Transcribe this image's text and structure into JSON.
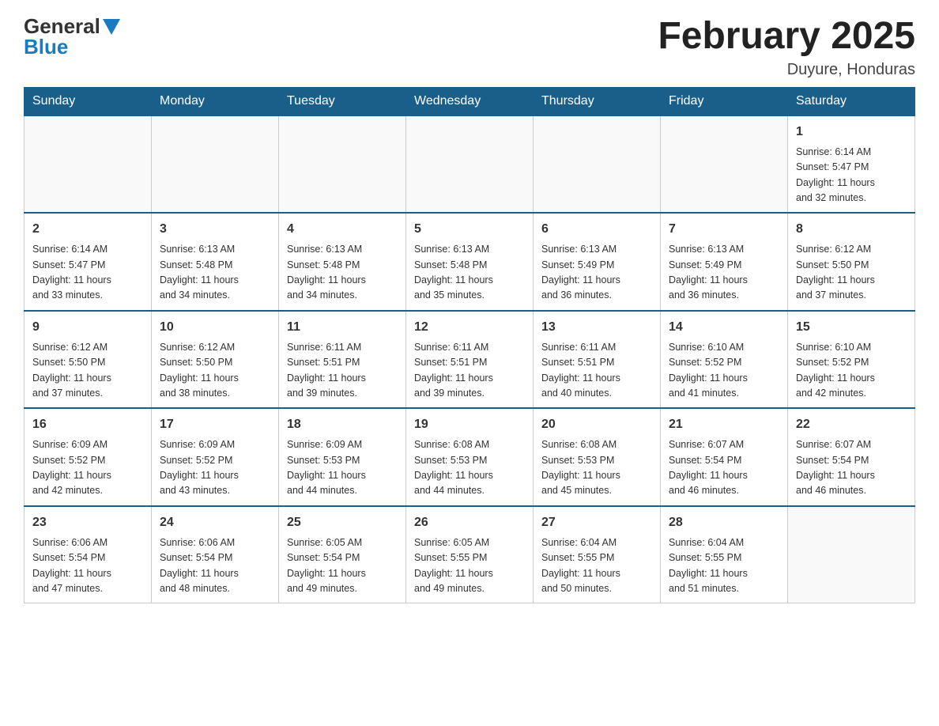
{
  "header": {
    "title": "February 2025",
    "subtitle": "Duyure, Honduras",
    "logo_general": "General",
    "logo_blue": "Blue"
  },
  "weekdays": [
    "Sunday",
    "Monday",
    "Tuesday",
    "Wednesday",
    "Thursday",
    "Friday",
    "Saturday"
  ],
  "weeks": [
    [
      {
        "day": "",
        "info": ""
      },
      {
        "day": "",
        "info": ""
      },
      {
        "day": "",
        "info": ""
      },
      {
        "day": "",
        "info": ""
      },
      {
        "day": "",
        "info": ""
      },
      {
        "day": "",
        "info": ""
      },
      {
        "day": "1",
        "info": "Sunrise: 6:14 AM\nSunset: 5:47 PM\nDaylight: 11 hours\nand 32 minutes."
      }
    ],
    [
      {
        "day": "2",
        "info": "Sunrise: 6:14 AM\nSunset: 5:47 PM\nDaylight: 11 hours\nand 33 minutes."
      },
      {
        "day": "3",
        "info": "Sunrise: 6:13 AM\nSunset: 5:48 PM\nDaylight: 11 hours\nand 34 minutes."
      },
      {
        "day": "4",
        "info": "Sunrise: 6:13 AM\nSunset: 5:48 PM\nDaylight: 11 hours\nand 34 minutes."
      },
      {
        "day": "5",
        "info": "Sunrise: 6:13 AM\nSunset: 5:48 PM\nDaylight: 11 hours\nand 35 minutes."
      },
      {
        "day": "6",
        "info": "Sunrise: 6:13 AM\nSunset: 5:49 PM\nDaylight: 11 hours\nand 36 minutes."
      },
      {
        "day": "7",
        "info": "Sunrise: 6:13 AM\nSunset: 5:49 PM\nDaylight: 11 hours\nand 36 minutes."
      },
      {
        "day": "8",
        "info": "Sunrise: 6:12 AM\nSunset: 5:50 PM\nDaylight: 11 hours\nand 37 minutes."
      }
    ],
    [
      {
        "day": "9",
        "info": "Sunrise: 6:12 AM\nSunset: 5:50 PM\nDaylight: 11 hours\nand 37 minutes."
      },
      {
        "day": "10",
        "info": "Sunrise: 6:12 AM\nSunset: 5:50 PM\nDaylight: 11 hours\nand 38 minutes."
      },
      {
        "day": "11",
        "info": "Sunrise: 6:11 AM\nSunset: 5:51 PM\nDaylight: 11 hours\nand 39 minutes."
      },
      {
        "day": "12",
        "info": "Sunrise: 6:11 AM\nSunset: 5:51 PM\nDaylight: 11 hours\nand 39 minutes."
      },
      {
        "day": "13",
        "info": "Sunrise: 6:11 AM\nSunset: 5:51 PM\nDaylight: 11 hours\nand 40 minutes."
      },
      {
        "day": "14",
        "info": "Sunrise: 6:10 AM\nSunset: 5:52 PM\nDaylight: 11 hours\nand 41 minutes."
      },
      {
        "day": "15",
        "info": "Sunrise: 6:10 AM\nSunset: 5:52 PM\nDaylight: 11 hours\nand 42 minutes."
      }
    ],
    [
      {
        "day": "16",
        "info": "Sunrise: 6:09 AM\nSunset: 5:52 PM\nDaylight: 11 hours\nand 42 minutes."
      },
      {
        "day": "17",
        "info": "Sunrise: 6:09 AM\nSunset: 5:52 PM\nDaylight: 11 hours\nand 43 minutes."
      },
      {
        "day": "18",
        "info": "Sunrise: 6:09 AM\nSunset: 5:53 PM\nDaylight: 11 hours\nand 44 minutes."
      },
      {
        "day": "19",
        "info": "Sunrise: 6:08 AM\nSunset: 5:53 PM\nDaylight: 11 hours\nand 44 minutes."
      },
      {
        "day": "20",
        "info": "Sunrise: 6:08 AM\nSunset: 5:53 PM\nDaylight: 11 hours\nand 45 minutes."
      },
      {
        "day": "21",
        "info": "Sunrise: 6:07 AM\nSunset: 5:54 PM\nDaylight: 11 hours\nand 46 minutes."
      },
      {
        "day": "22",
        "info": "Sunrise: 6:07 AM\nSunset: 5:54 PM\nDaylight: 11 hours\nand 46 minutes."
      }
    ],
    [
      {
        "day": "23",
        "info": "Sunrise: 6:06 AM\nSunset: 5:54 PM\nDaylight: 11 hours\nand 47 minutes."
      },
      {
        "day": "24",
        "info": "Sunrise: 6:06 AM\nSunset: 5:54 PM\nDaylight: 11 hours\nand 48 minutes."
      },
      {
        "day": "25",
        "info": "Sunrise: 6:05 AM\nSunset: 5:54 PM\nDaylight: 11 hours\nand 49 minutes."
      },
      {
        "day": "26",
        "info": "Sunrise: 6:05 AM\nSunset: 5:55 PM\nDaylight: 11 hours\nand 49 minutes."
      },
      {
        "day": "27",
        "info": "Sunrise: 6:04 AM\nSunset: 5:55 PM\nDaylight: 11 hours\nand 50 minutes."
      },
      {
        "day": "28",
        "info": "Sunrise: 6:04 AM\nSunset: 5:55 PM\nDaylight: 11 hours\nand 51 minutes."
      },
      {
        "day": "",
        "info": ""
      }
    ]
  ]
}
